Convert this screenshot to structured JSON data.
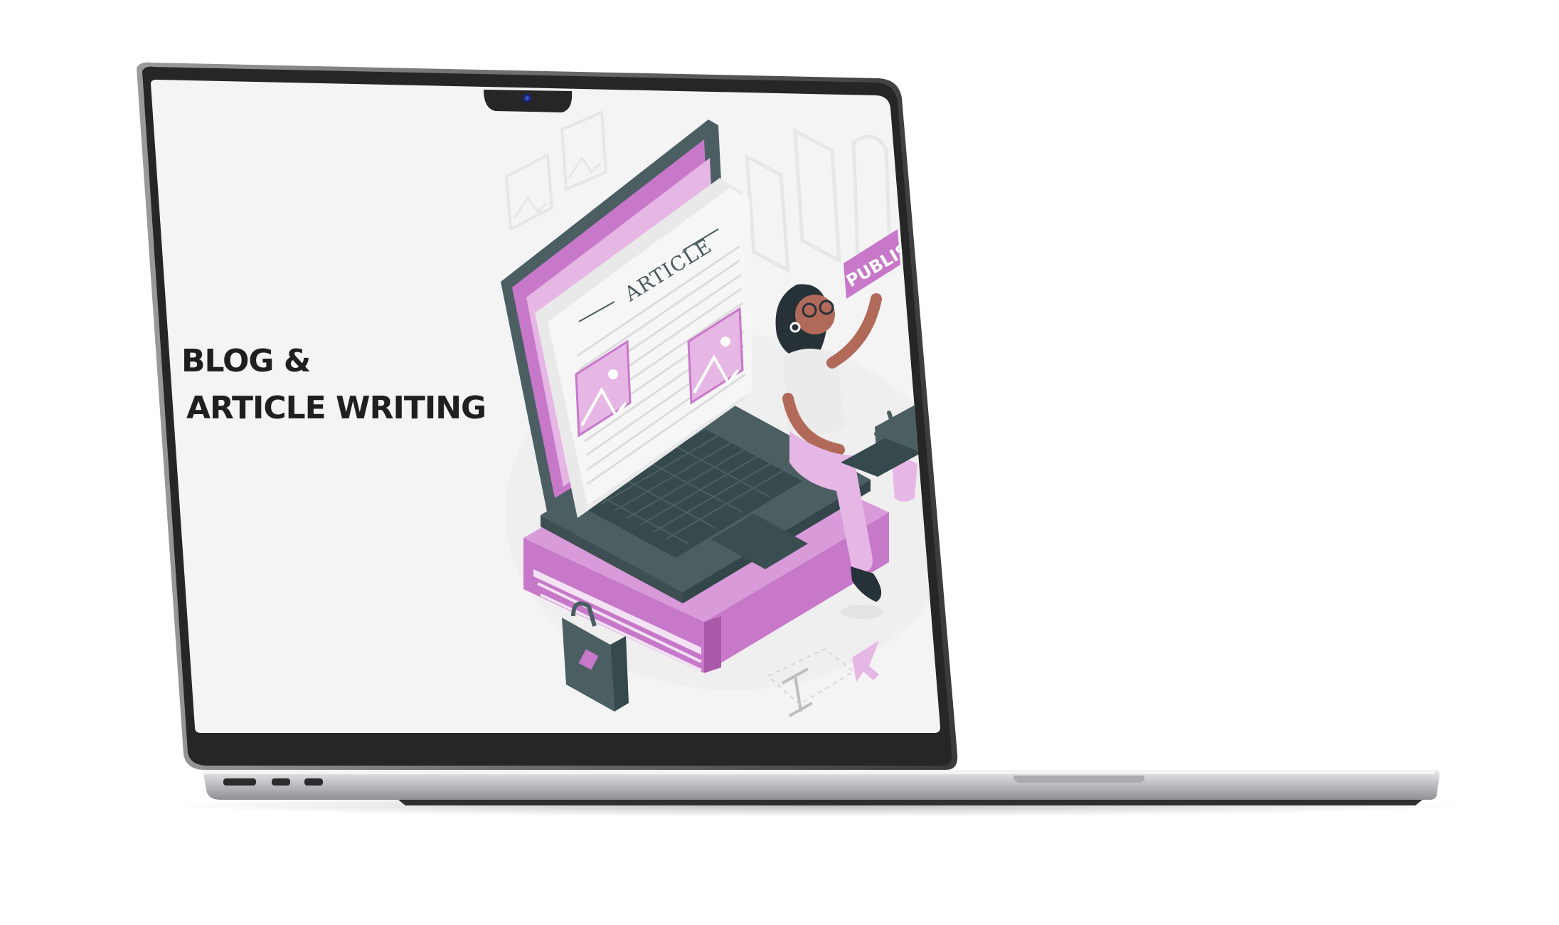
{
  "screen": {
    "headline_line1": "BLOG &",
    "headline_line2": "ARTICLE WRITING"
  },
  "illustration": {
    "document_title": "ARTICLE",
    "publish_label": "PUBLISH"
  },
  "colors": {
    "accent_pink": "#c778c9",
    "light_pink": "#e6b6e4",
    "laptop_dark": "#4b5f63",
    "screen_bg": "#f4f4f4",
    "bezel": "#2a2a2a",
    "aluminum": "#cfd0d2"
  },
  "icons": [
    "webcam-icon",
    "image-placeholder-icon",
    "mouse-cursor-icon",
    "text-cursor-icon",
    "briefcase-icon",
    "plant-icon"
  ]
}
